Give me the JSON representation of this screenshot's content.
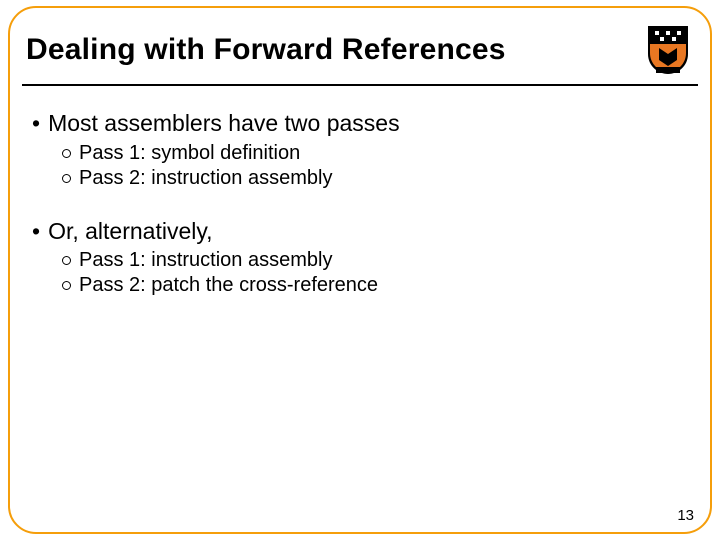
{
  "slide": {
    "title": "Dealing with Forward References",
    "page_number": "13",
    "bullets": [
      {
        "text": "Most assemblers have two passes",
        "sub": [
          "Pass 1: symbol definition",
          "Pass 2: instruction assembly"
        ]
      },
      {
        "text": "Or, alternatively,",
        "sub": [
          "Pass 1: instruction assembly",
          "Pass 2: patch the cross-reference"
        ]
      }
    ]
  }
}
